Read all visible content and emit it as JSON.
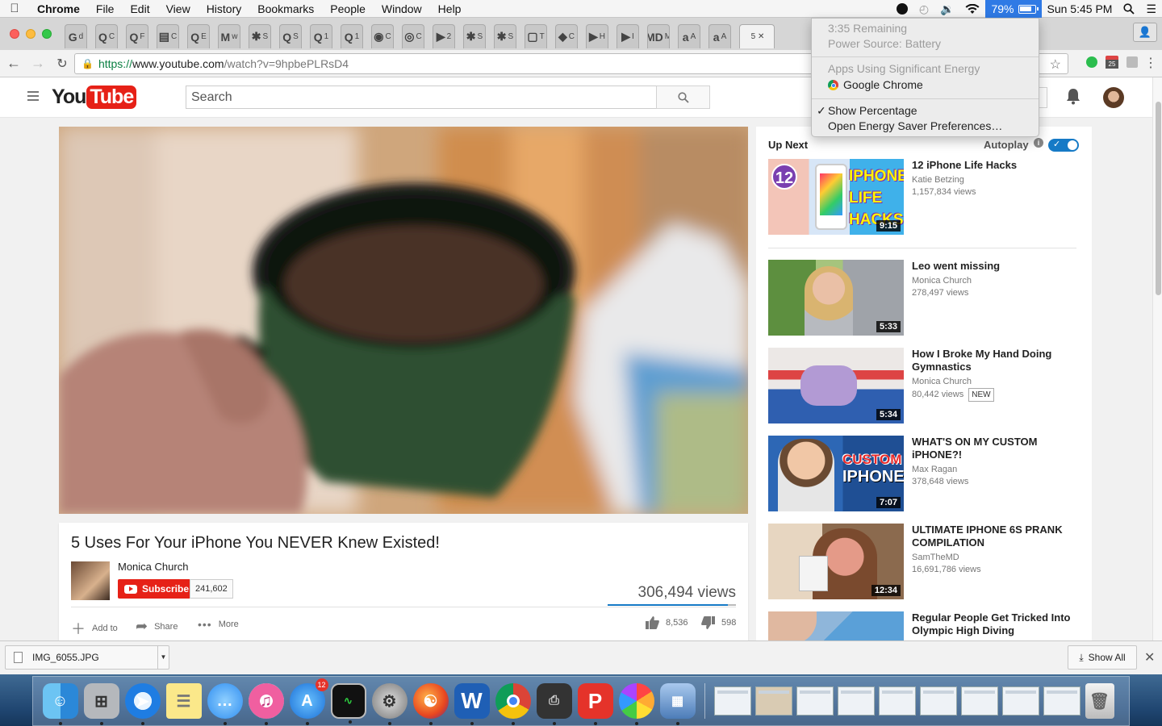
{
  "menubar": {
    "app_name": "Chrome",
    "items": [
      "File",
      "Edit",
      "View",
      "History",
      "Bookmarks",
      "People",
      "Window",
      "Help"
    ],
    "battery_percent": "79%",
    "clock": "Sun 5:45 PM"
  },
  "energy_menu": {
    "time_remaining": "3:35 Remaining",
    "power_source": "Power Source: Battery",
    "apps_header": "Apps Using Significant Energy",
    "app": "Google Chrome",
    "show_percentage": "Show Percentage",
    "show_percentage_checked": true,
    "preferences": "Open Energy Saver Preferences…"
  },
  "tabs": [
    {
      "fav": "G",
      "label": "d"
    },
    {
      "fav": "Q",
      "label": "C"
    },
    {
      "fav": "Q",
      "label": "F"
    },
    {
      "fav": "▤",
      "label": "C"
    },
    {
      "fav": "Q",
      "label": "E"
    },
    {
      "fav": "M",
      "label": "w"
    },
    {
      "fav": "✱",
      "label": "S"
    },
    {
      "fav": "Q",
      "label": "S"
    },
    {
      "fav": "Q",
      "label": "1"
    },
    {
      "fav": "Q",
      "label": "1"
    },
    {
      "fav": "◉",
      "label": "C"
    },
    {
      "fav": "◎",
      "label": "C"
    },
    {
      "fav": "▶",
      "label": "2"
    },
    {
      "fav": "✱",
      "label": "S"
    },
    {
      "fav": "✱",
      "label": "S"
    },
    {
      "fav": "▢",
      "label": "T"
    },
    {
      "fav": "◆",
      "label": "C"
    },
    {
      "fav": "▶",
      "label": "H"
    },
    {
      "fav": "▶",
      "label": "I"
    },
    {
      "fav": "MD",
      "label": "M"
    },
    {
      "fav": "a",
      "label": "A"
    },
    {
      "fav": "a",
      "label": "A"
    },
    {
      "fav": "",
      "label": "5 ✕"
    }
  ],
  "toolbar": {
    "url_scheme": "https://",
    "url_host": "www.youtube.com",
    "url_path": "/watch?v=9hpbePLRsD4",
    "calendar_badge": "25"
  },
  "youtube": {
    "logo_you": "You",
    "logo_tube": "Tube",
    "search_placeholder": "Search",
    "video": {
      "title": "5 Uses For Your iPhone You NEVER Knew Existed!",
      "channel": "Monica Church",
      "subscribe_label": "Subscribe",
      "subscriber_count": "241,602",
      "views": "306,494 views",
      "like_ratio": 0.935,
      "add_to": "Add to",
      "share": "Share",
      "more": "More",
      "likes": "8,536",
      "dislikes": "598"
    },
    "sidebar": {
      "up_next": "Up Next",
      "autoplay": "Autoplay",
      "autoplay_on": true,
      "videos": [
        {
          "title": "12 iPhone Life Hacks",
          "channel": "Katie Betzing",
          "views": "1,157,834 views",
          "duration": "9:15",
          "badge": "",
          "thumb_text_a": "12",
          "thumb_text_b": "IPHONE LIFE HACKS"
        },
        {
          "title": "Leo went missing",
          "channel": "Monica Church",
          "views": "278,497 views",
          "duration": "5:33",
          "badge": ""
        },
        {
          "title": "How I Broke My Hand Doing Gymnastics",
          "channel": "Monica Church",
          "views": "80,442 views",
          "duration": "5:34",
          "badge": "NEW"
        },
        {
          "title": "WHAT'S ON MY CUSTOM iPHONE?!",
          "channel": "Max Ragan",
          "views": "378,648 views",
          "duration": "7:07",
          "badge": "",
          "thumb_text_a": "CUSTOM",
          "thumb_text_b": "IPHONE"
        },
        {
          "title": "ULTIMATE IPHONE 6S PRANK COMPILATION",
          "channel": "SamTheMD",
          "views": "16,691,786 views",
          "duration": "12:34",
          "badge": ""
        },
        {
          "title": "Regular People Get Tricked Into Olympic High Diving",
          "channel": "",
          "views": "",
          "duration": "",
          "badge": ""
        }
      ]
    }
  },
  "downloads": {
    "file": "IMG_6055.JPG",
    "show_all": "Show All"
  },
  "dock": {
    "appstore_badge": "12"
  }
}
